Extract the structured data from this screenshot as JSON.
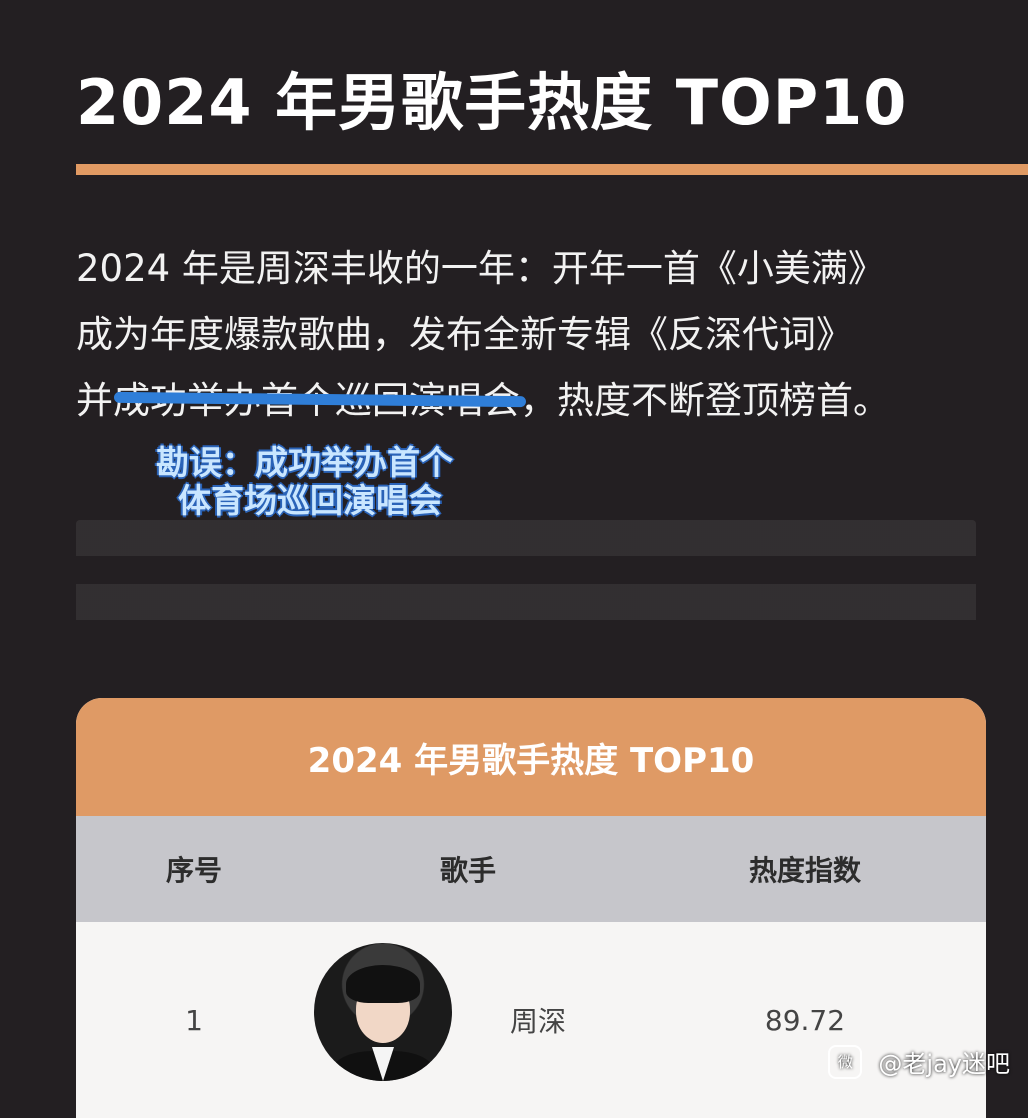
{
  "page": {
    "title": "2024 年男歌手热度 TOP10"
  },
  "intro": {
    "line1": "2024 年是周深丰收的一年：开年一首《小美满》",
    "line2": "成为年度爆款歌曲，发布全新专辑《反深代词》",
    "line3_prefix": "并",
    "line3_struck": "成功举办首个巡回演唱会",
    "line3_suffix": "，热度不断登顶榜首。"
  },
  "correction": {
    "line1": "勘误：成功举办首个",
    "line2": "体育场巡回演唱会"
  },
  "table": {
    "title": "2024 年男歌手热度 TOP10",
    "headers": {
      "rank": "序号",
      "singer": "歌手",
      "heat": "热度指数"
    },
    "rows": [
      {
        "rank": "1",
        "singer": "周深",
        "heat": "89.72"
      }
    ]
  },
  "watermark": {
    "icon": "微",
    "text": "@老jay迷吧"
  },
  "colors": {
    "background": "#231f22",
    "accent": "#e19a63",
    "strike": "#2f7ed8",
    "header_gray": "#c6c6cb"
  }
}
